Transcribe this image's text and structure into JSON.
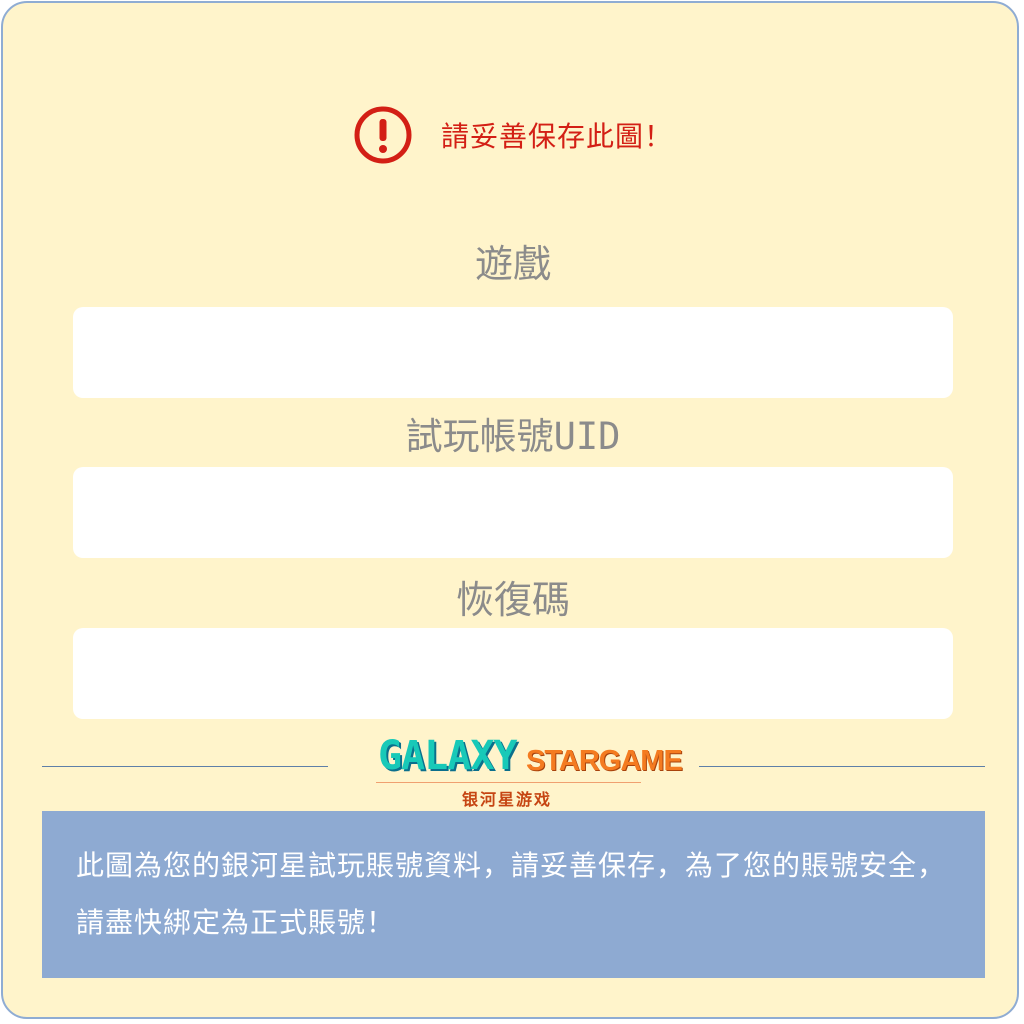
{
  "warning": {
    "icon": "exclamation-circle-icon",
    "text": "請妥善保存此圖！",
    "color": "#d31f15"
  },
  "fields": {
    "game": {
      "label": "遊戲",
      "value": ""
    },
    "trial_uid": {
      "label": "試玩帳號UID",
      "value": ""
    },
    "recovery_code": {
      "label": "恢復碼",
      "value": ""
    }
  },
  "logo": {
    "galaxy": "GALAXY",
    "stargame": "STARGAME",
    "chinese": "银河星游戏"
  },
  "notice": {
    "text": "此圖為您的銀河星試玩賬號資料，請妥善保存，為了您的賬號安全，請盡快綁定為正式賬號！"
  },
  "colors": {
    "background": "#fff4cb",
    "border": "#8facd3",
    "notice_background": "#8eaad2",
    "label": "#8b8b8b",
    "logo_teal": "#18c9b8",
    "logo_orange": "#f47b20"
  }
}
